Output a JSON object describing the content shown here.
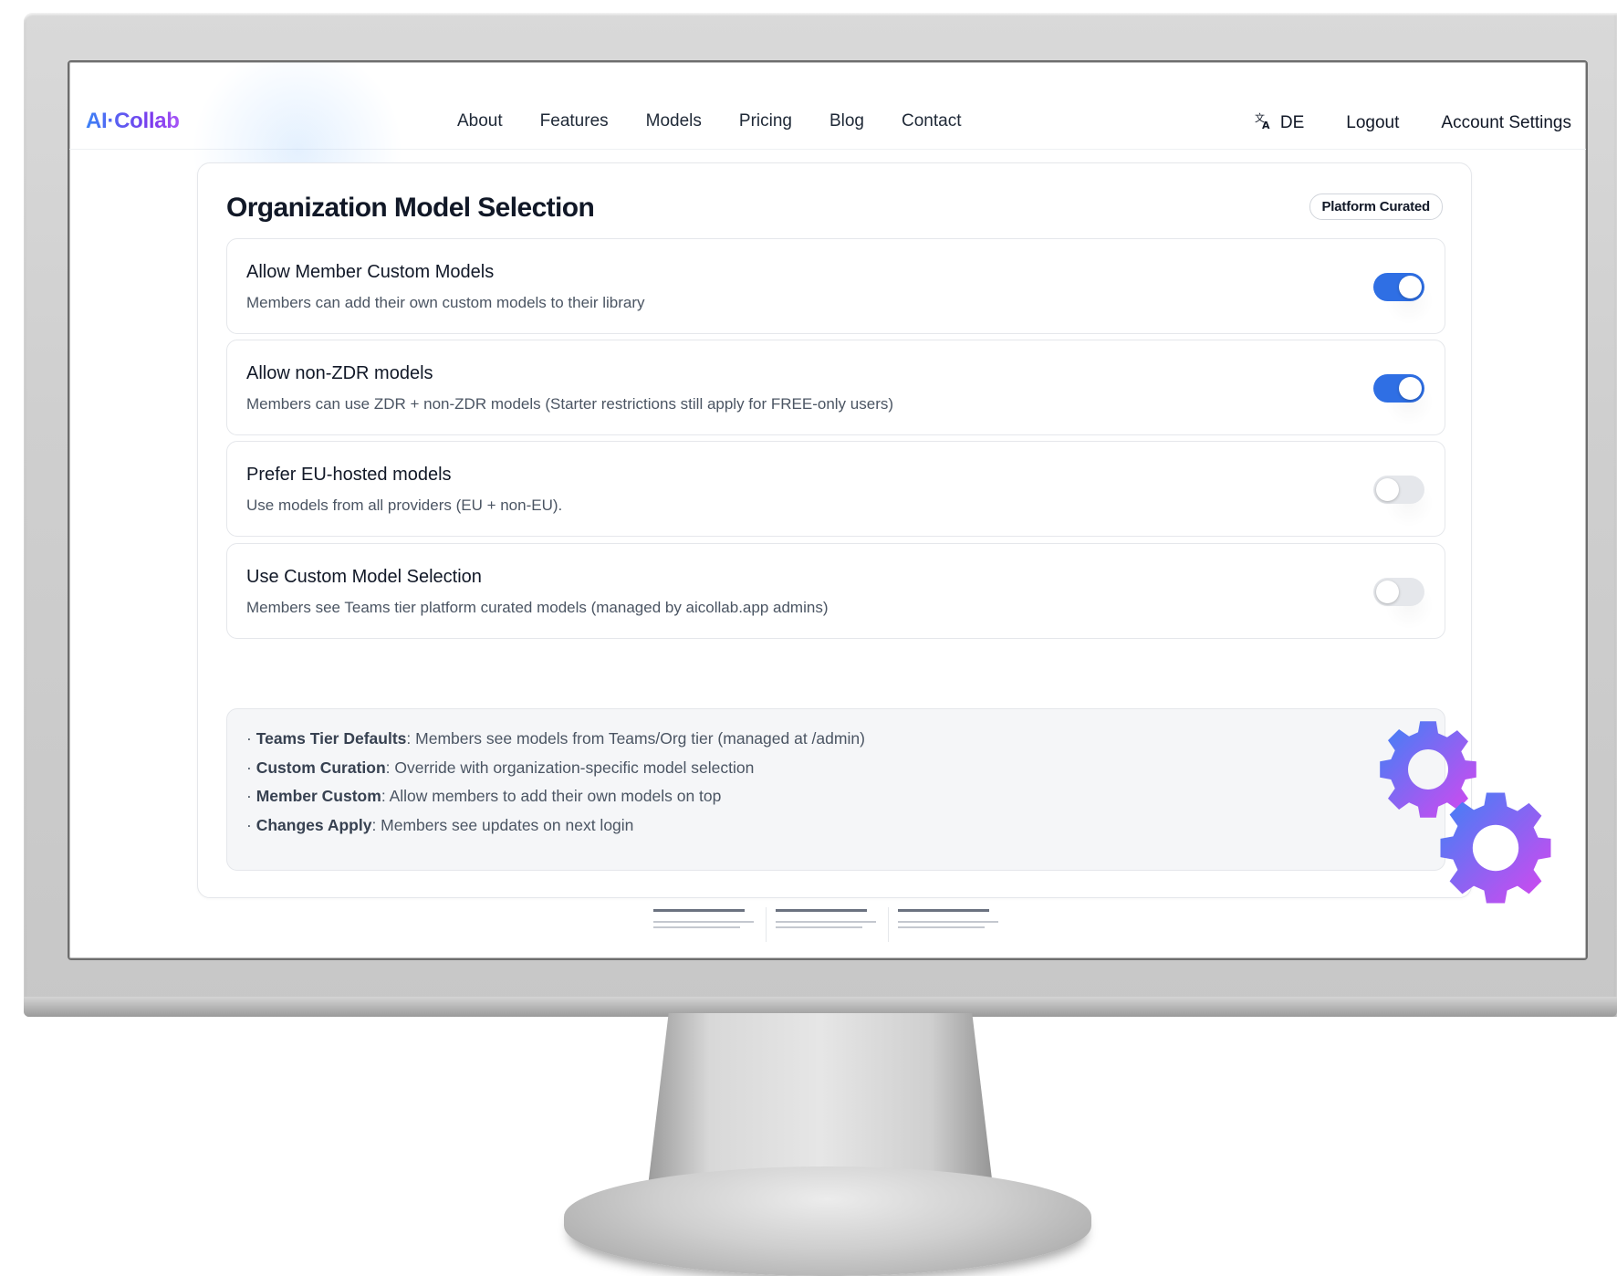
{
  "brand": "AI·Collab",
  "nav": {
    "links": [
      "About",
      "Features",
      "Models",
      "Pricing",
      "Blog",
      "Contact"
    ],
    "language": "DE",
    "language_icon": "translate-icon",
    "logout": "Logout",
    "account_settings": "Account Settings"
  },
  "card": {
    "title": "Organization Model Selection",
    "badge": "Platform Curated",
    "settings": [
      {
        "title": "Allow Member Custom Models",
        "description": "Members can add their own custom models to their library",
        "enabled": true
      },
      {
        "title": "Allow non-ZDR models",
        "description": "Members can use ZDR + non-ZDR models (Starter restrictions still apply for FREE-only users)",
        "enabled": true
      },
      {
        "title": "Prefer EU-hosted models",
        "description": "Use models from all providers (EU + non-EU).",
        "enabled": false
      },
      {
        "title": "Use Custom Model Selection",
        "description": "Members see Teams tier platform curated models (managed by aicollab.app admins)",
        "enabled": false
      }
    ],
    "info": [
      {
        "label": "Teams Tier Defaults",
        "text": ": Members see models from Teams/Org tier (managed at /admin)"
      },
      {
        "label": "Custom Curation",
        "text": ": Override with organization-specific model selection"
      },
      {
        "label": "Member Custom",
        "text": ": Allow members to add their own models on top"
      },
      {
        "label": "Changes Apply",
        "text": ": Members see updates on next login"
      }
    ],
    "bullet": "·"
  },
  "colors": {
    "accent": "#2f6fe4",
    "brand_gradient_start": "#3b82f6",
    "brand_gradient_end": "#a855f7",
    "gear_gradient_start": "#3b82f6",
    "gear_gradient_end": "#d946ef"
  }
}
